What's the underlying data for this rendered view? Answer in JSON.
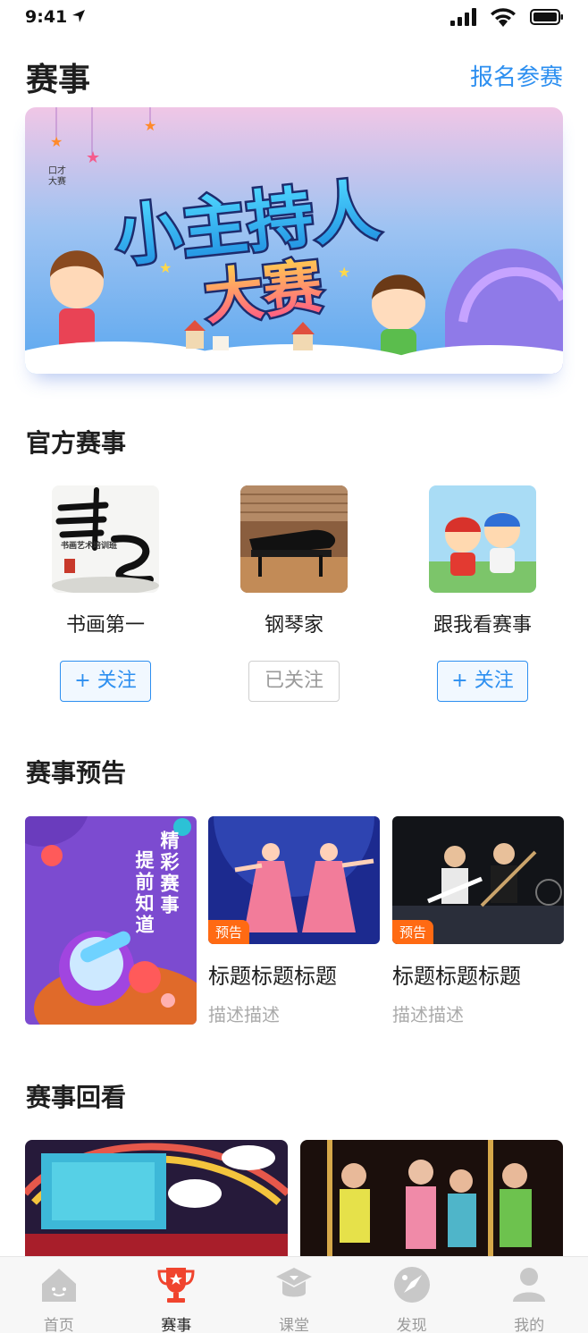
{
  "status_bar": {
    "time": "9:41"
  },
  "header": {
    "title": "赛事",
    "action_label": "报名参赛"
  },
  "banner": {
    "headline_line1": "小主持人",
    "headline_line2": "大赛",
    "corner_text": "口才\n大赛"
  },
  "official": {
    "title": "官方赛事",
    "items": [
      {
        "name": "书画第一",
        "follow_label": "+ 关注",
        "followed": false,
        "thumb_text": "书画艺术培训班"
      },
      {
        "name": "钢琴家",
        "follow_label": "已关注",
        "followed": true
      },
      {
        "name": "跟我看赛事",
        "follow_label": "+ 关注",
        "followed": false
      }
    ]
  },
  "preview": {
    "title": "赛事预告",
    "promo_lines": [
      "精彩赛事",
      "提前知道"
    ],
    "cards": [
      {
        "tag": "预告",
        "title": "标题标题标题",
        "desc": "描述描述"
      },
      {
        "tag": "预告",
        "title": "标题标题标题",
        "desc": "描述描述"
      }
    ]
  },
  "replay": {
    "title": "赛事回看"
  },
  "tabbar": {
    "active_index": 1,
    "tabs": [
      {
        "label": "首页",
        "icon": "home-icon"
      },
      {
        "label": "赛事",
        "icon": "trophy-icon"
      },
      {
        "label": "课堂",
        "icon": "classroom-icon"
      },
      {
        "label": "发现",
        "icon": "discover-icon"
      },
      {
        "label": "我的",
        "icon": "profile-icon"
      }
    ]
  },
  "colors": {
    "accent": "#2d8ff0",
    "tag": "#ff6a13",
    "active_tab_icon": "#f0442e",
    "inactive_tab_icon": "#c8c8c8"
  }
}
